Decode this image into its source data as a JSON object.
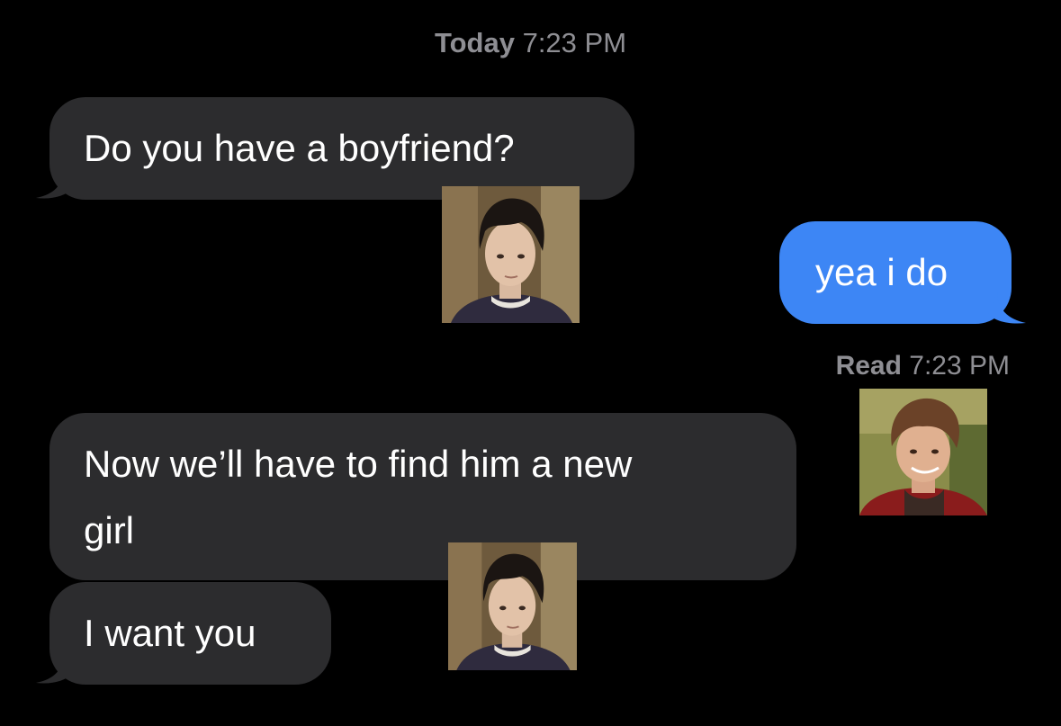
{
  "conversation": {
    "timestamp_day": "Today",
    "timestamp_time": "7:23 PM",
    "read_receipt_label": "Read",
    "read_receipt_time": "7:23 PM",
    "messages": [
      {
        "sender": "them",
        "text": "Do you have a boyfriend?"
      },
      {
        "sender": "me",
        "text": "yea i do"
      },
      {
        "sender": "them",
        "text_line1": "Now we’ll have to find him a new",
        "text_line2": "girl"
      },
      {
        "sender": "them",
        "text": "I want you"
      }
    ]
  },
  "colors": {
    "background": "#000000",
    "incoming_bubble": "#2c2c2e",
    "outgoing_bubble": "#3d86f5",
    "meta_text": "#8e8e93"
  }
}
